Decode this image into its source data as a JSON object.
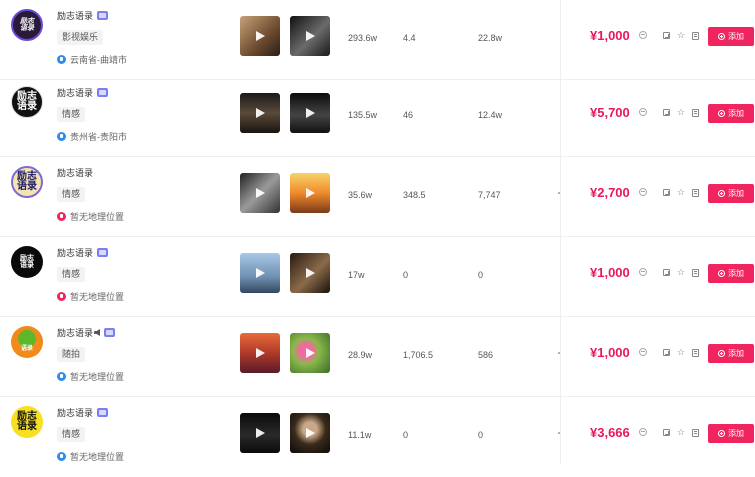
{
  "rows": [
    {
      "avatar_text": "励志\n语录",
      "name": "励志语录",
      "badge": "vip-badge",
      "tag": "影视娱乐",
      "location": "云南省-曲靖市",
      "location_icon_color": "#2d8cf0",
      "metrics": [
        "293.6w",
        "4.4",
        "22.8w"
      ],
      "price": "¥1,000",
      "add_label": "添加"
    },
    {
      "avatar_text": "励志\n语录",
      "name": "励志语录",
      "badge": "vip-badge",
      "tag": "情感",
      "location": "贵州省-贵阳市",
      "location_icon_color": "#2d8cf0",
      "metrics": [
        "135.5w",
        "46",
        "12.4w"
      ],
      "price": "¥5,700",
      "add_label": "添加"
    },
    {
      "avatar_text": "励志\n语录",
      "name": "励志语录",
      "badge": "",
      "tag": "情感",
      "location": "暂无地理位置",
      "location_icon_color": "#f0245e",
      "metrics": [
        "35.6w",
        "348.5",
        "7,747"
      ],
      "price": "¥2,700",
      "add_label": "添加"
    },
    {
      "avatar_text": "励志\n语录",
      "name": "励志语录",
      "badge": "vip-badge",
      "tag": "情感",
      "location": "暂无地理位置",
      "location_icon_color": "#f0245e",
      "metrics": [
        "17w",
        "0",
        "0"
      ],
      "price": "¥1,000",
      "add_label": "添加"
    },
    {
      "avatar_text": "语录",
      "name": "励志语录",
      "badge": "vip-badge",
      "tag": "随拍",
      "location": "暂无地理位置",
      "location_icon_color": "#2d8cf0",
      "metrics": [
        "28.9w",
        "1,706.5",
        "586"
      ],
      "price": "¥1,000",
      "add_label": "添加"
    },
    {
      "avatar_text": "励志\n语录",
      "name": "励志语录",
      "badge": "vip-badge",
      "tag": "情感",
      "location": "暂无地理位置",
      "location_icon_color": "#2d8cf0",
      "metrics": [
        "11.1w",
        "0",
        "0"
      ],
      "price": "¥3,666",
      "add_label": "添加"
    }
  ],
  "colors": {
    "accent": "#f0245e",
    "price": "#e8185a",
    "vip": "#7b7ff5"
  },
  "icons": {
    "price_info": "minus-circle-icon",
    "edit": "edit-icon",
    "favorite": "star-icon",
    "calendar": "calendar-icon",
    "add": "plus-circle-icon",
    "location": "location-icon",
    "play": "play-icon"
  }
}
